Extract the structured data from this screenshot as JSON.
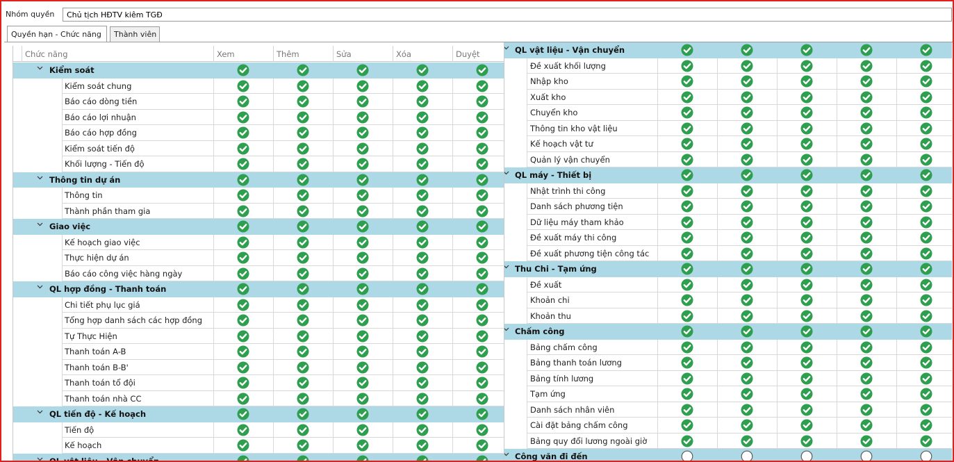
{
  "group_label": "Nhóm quyền",
  "group_value": "Chủ tịch HĐTV kiêm TGĐ",
  "tabs": [
    "Quyền hạn - Chức năng",
    "Thành viên"
  ],
  "columns": [
    "Chức năng",
    "Xem",
    "Thêm",
    "Sửa",
    "Xóa",
    "Duyệt"
  ],
  "colors": {
    "group_row": "#add8e6",
    "check_fill": "#2e9e4f",
    "frame_border": "#e0201c"
  },
  "icon_names": {
    "checked": "check-circle-icon",
    "unchecked": "empty-circle-icon",
    "expand": "chevron-down-icon"
  },
  "left_rows": [
    {
      "type": "group",
      "label": "Kiểm soát",
      "checked": true
    },
    {
      "type": "item",
      "label": "Kiểm soát chung",
      "checked": true
    },
    {
      "type": "item",
      "label": "Báo cáo dòng tiền",
      "checked": true
    },
    {
      "type": "item",
      "label": "Báo cáo lợi nhuận",
      "checked": true
    },
    {
      "type": "item",
      "label": "Báo cáo hợp đồng",
      "checked": true
    },
    {
      "type": "item",
      "label": "Kiểm soát tiến độ",
      "checked": true
    },
    {
      "type": "item",
      "label": "Khối lượng - Tiến độ",
      "checked": true
    },
    {
      "type": "group",
      "label": "Thông tin dự án",
      "checked": true
    },
    {
      "type": "item",
      "label": "Thông tin",
      "checked": true
    },
    {
      "type": "item",
      "label": "Thành phần tham gia",
      "checked": true
    },
    {
      "type": "group",
      "label": "Giao việc",
      "checked": true
    },
    {
      "type": "item",
      "label": "Kế hoạch giao việc",
      "checked": true
    },
    {
      "type": "item",
      "label": "Thực hiện dự án",
      "checked": true
    },
    {
      "type": "item",
      "label": "Báo cáo công việc hàng ngày",
      "checked": true
    },
    {
      "type": "group",
      "label": "QL hợp đồng - Thanh toán",
      "checked": true
    },
    {
      "type": "item",
      "label": "Chi tiết phụ lục giá",
      "checked": true
    },
    {
      "type": "item",
      "label": "Tổng hợp danh sách các hợp đồng",
      "checked": true
    },
    {
      "type": "item",
      "label": "Tự Thực Hiện",
      "checked": true
    },
    {
      "type": "item",
      "label": "Thanh toán A-B",
      "checked": true
    },
    {
      "type": "item",
      "label": "Thanh toán B-B'",
      "checked": true
    },
    {
      "type": "item",
      "label": "Thanh toán tổ đội",
      "checked": true
    },
    {
      "type": "item",
      "label": "Thanh toán nhà CC",
      "checked": true
    },
    {
      "type": "group",
      "label": "QL tiến độ - Kế hoạch",
      "checked": true
    },
    {
      "type": "item",
      "label": "Tiến độ",
      "checked": true
    },
    {
      "type": "item",
      "label": "Kế hoạch",
      "checked": true
    },
    {
      "type": "group",
      "label": "QL vật liệu - Vận chuyển",
      "checked": true
    }
  ],
  "right_rows": [
    {
      "type": "group",
      "label": "QL vật liệu - Vận chuyển",
      "checked": true
    },
    {
      "type": "item",
      "label": "Đề xuất khối lượng",
      "checked": true
    },
    {
      "type": "item",
      "label": "Nhập kho",
      "checked": true
    },
    {
      "type": "item",
      "label": "Xuất kho",
      "checked": true
    },
    {
      "type": "item",
      "label": "Chuyển kho",
      "checked": true
    },
    {
      "type": "item",
      "label": "Thông tin kho vật liệu",
      "checked": true
    },
    {
      "type": "item",
      "label": "Kế hoạch vật tư",
      "checked": true
    },
    {
      "type": "item",
      "label": "Quản lý vận chuyển",
      "checked": true
    },
    {
      "type": "group",
      "label": "QL máy - Thiết bị",
      "checked": true
    },
    {
      "type": "item",
      "label": "Nhật trình thi công",
      "checked": true
    },
    {
      "type": "item",
      "label": "Danh sách phương tiện",
      "checked": true
    },
    {
      "type": "item",
      "label": "Dữ liệu máy tham khảo",
      "checked": true
    },
    {
      "type": "item",
      "label": "Đề xuất máy thi công",
      "checked": true
    },
    {
      "type": "item",
      "label": "Đề xuất phương tiện công tác",
      "checked": true
    },
    {
      "type": "group",
      "label": "Thu Chi - Tạm ứng",
      "checked": true
    },
    {
      "type": "item",
      "label": "Đề xuất",
      "checked": true
    },
    {
      "type": "item",
      "label": "Khoản chi",
      "checked": true
    },
    {
      "type": "item",
      "label": "Khoản thu",
      "checked": true
    },
    {
      "type": "group",
      "label": "Chấm công",
      "checked": true
    },
    {
      "type": "item",
      "label": "Bảng chấm công",
      "checked": true
    },
    {
      "type": "item",
      "label": "Bảng thanh toán lương",
      "checked": true
    },
    {
      "type": "item",
      "label": "Bảng tính lương",
      "checked": true
    },
    {
      "type": "item",
      "label": "Tạm ứng",
      "checked": true
    },
    {
      "type": "item",
      "label": "Danh sách nhân viên",
      "checked": true
    },
    {
      "type": "item",
      "label": "Cài đặt bảng chấm công",
      "checked": true
    },
    {
      "type": "item",
      "label": "Bảng quy đổi lương ngoài giờ",
      "checked": true
    },
    {
      "type": "group",
      "label": "Công văn đi đến",
      "checked": false
    }
  ]
}
